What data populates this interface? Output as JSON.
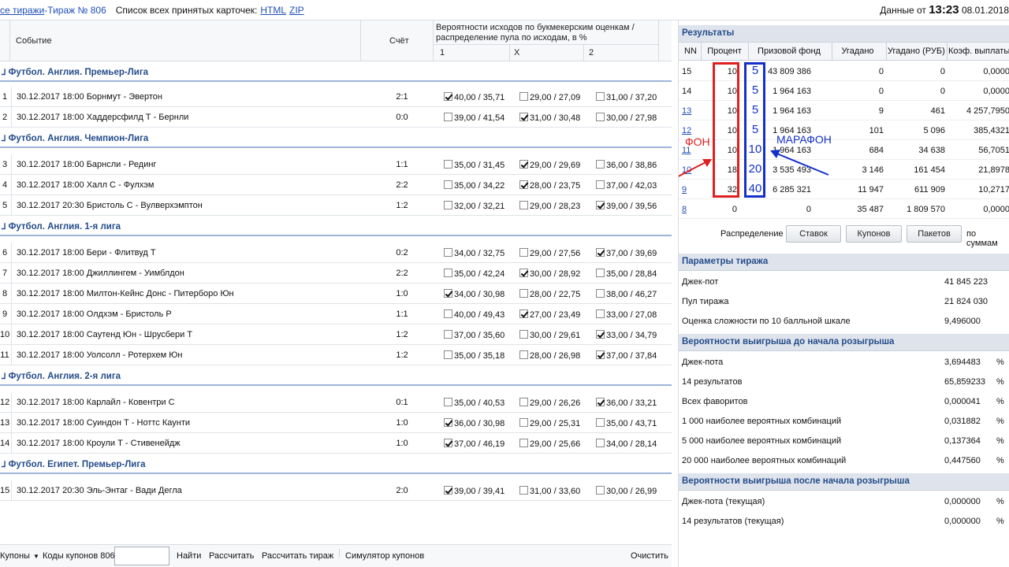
{
  "topbar": {
    "all_draws": "се тиражи",
    "sep": " - ",
    "draw": "Тираж № 806",
    "list_label": "Список всех принятых карточек:",
    "html": "HTML",
    "zip": "ZIP",
    "data_label": "Данные от",
    "time": "13:23",
    "date": "08.01.2018"
  },
  "header": {
    "event": "Событие",
    "score": "Счёт",
    "prob_line1": "Вероятности исходов по букмекерским оценкам /",
    "prob_line2": "распределение пула по исходам, в %",
    "c1": "1",
    "cx": "X",
    "c2": "2"
  },
  "sections": [
    "Футбол. Англия. Премьер-Лига",
    "Футбол. Англия. Чемпион-Лига",
    "Футбол. Англия. 1-я лига",
    "Футбол. Англия. 2-я лига",
    "Футбол. Египет. Премьер-Лига"
  ],
  "events": [
    {
      "n": "1",
      "name": "30.12.2017 18:00 Борнмут - Эвертон",
      "score": "2:1",
      "p1": "40,00 / 35,71",
      "px": "29,00 / 27,09",
      "p2": "31,00 / 37,20",
      "chk": [
        1,
        0,
        0
      ]
    },
    {
      "n": "2",
      "name": "30.12.2017 18:00 Хаддерсфилд Т - Бернли",
      "score": "0:0",
      "p1": "39,00 / 41,54",
      "px": "31,00 / 30,48",
      "p2": "30,00 / 27,98",
      "chk": [
        0,
        1,
        0
      ]
    },
    {
      "n": "3",
      "name": "30.12.2017 18:00 Барнсли - Рединг",
      "score": "1:1",
      "p1": "35,00 / 31,45",
      "px": "29,00 / 29,69",
      "p2": "36,00 / 38,86",
      "chk": [
        0,
        1,
        0
      ]
    },
    {
      "n": "4",
      "name": "30.12.2017 18:00 Халл С - Фулхэм",
      "score": "2:2",
      "p1": "35,00 / 34,22",
      "px": "28,00 / 23,75",
      "p2": "37,00 / 42,03",
      "chk": [
        0,
        1,
        0
      ]
    },
    {
      "n": "5",
      "name": "30.12.2017 20:30 Бристоль С - Вулверхэмптон",
      "score": "1:2",
      "p1": "32,00 / 32,21",
      "px": "29,00 / 28,23",
      "p2": "39,00 / 39,56",
      "chk": [
        0,
        0,
        1
      ]
    },
    {
      "n": "6",
      "name": "30.12.2017 18:00 Бери - Флитвуд Т",
      "score": "0:2",
      "p1": "34,00 / 32,75",
      "px": "29,00 / 27,56",
      "p2": "37,00 / 39,69",
      "chk": [
        0,
        0,
        1
      ]
    },
    {
      "n": "7",
      "name": "30.12.2017 18:00 Джиллингем - Уимблдон",
      "score": "2:2",
      "p1": "35,00 / 42,24",
      "px": "30,00 / 28,92",
      "p2": "35,00 / 28,84",
      "chk": [
        0,
        1,
        0
      ]
    },
    {
      "n": "8",
      "name": "30.12.2017 18:00 Милтон-Кейнс Донс - Питерборо Юн",
      "score": "1:0",
      "p1": "34,00 / 30,98",
      "px": "28,00 / 22,75",
      "p2": "38,00 / 46,27",
      "chk": [
        1,
        0,
        0
      ]
    },
    {
      "n": "9",
      "name": "30.12.2017 18:00 Олдхэм - Бристоль Р",
      "score": "1:1",
      "p1": "40,00 / 49,43",
      "px": "27,00 / 23,49",
      "p2": "33,00 / 27,08",
      "chk": [
        0,
        1,
        0
      ]
    },
    {
      "n": "10",
      "name": "30.12.2017 18:00 Саутенд Юн - Шрусбери Т",
      "score": "1:2",
      "p1": "37,00 / 35,60",
      "px": "30,00 / 29,61",
      "p2": "33,00 / 34,79",
      "chk": [
        0,
        0,
        1
      ]
    },
    {
      "n": "11",
      "name": "30.12.2017 18:00 Уолсолл - Ротерхем Юн",
      "score": "1:2",
      "p1": "35,00 / 35,18",
      "px": "28,00 / 26,98",
      "p2": "37,00 / 37,84",
      "chk": [
        0,
        0,
        1
      ]
    },
    {
      "n": "12",
      "name": "30.12.2017 18:00 Карлайл - Ковентри С",
      "score": "0:1",
      "p1": "35,00 / 40,53",
      "px": "29,00 / 26,26",
      "p2": "36,00 / 33,21",
      "chk": [
        0,
        0,
        1
      ]
    },
    {
      "n": "13",
      "name": "30.12.2017 18:00 Суиндон Т - Ноттс Каунти",
      "score": "1:0",
      "p1": "36,00 / 30,98",
      "px": "29,00 / 25,31",
      "p2": "35,00 / 43,71",
      "chk": [
        1,
        0,
        0
      ]
    },
    {
      "n": "14",
      "name": "30.12.2017 18:00 Кроули Т - Стивенейдж",
      "score": "1:0",
      "p1": "37,00 / 46,19",
      "px": "29,00 / 25,66",
      "p2": "34,00 / 28,14",
      "chk": [
        1,
        0,
        0
      ]
    },
    {
      "n": "15",
      "name": "30.12.2017 20:30 Эль-Энтаг - Вади Дегла",
      "score": "2:0",
      "p1": "39,00 / 39,41",
      "px": "31,00 / 33,60",
      "p2": "30,00 / 26,99",
      "chk": [
        1,
        0,
        0
      ]
    }
  ],
  "footer": {
    "coupons": "Купоны",
    "codes": "Коды купонов 806-",
    "find": "Найти",
    "calc": "Рассчитать",
    "calc_draw": "Рассчитать тираж",
    "sim": "Симулятор купонов",
    "clear": "Очистить"
  },
  "results": {
    "title": "Результаты",
    "cols": [
      "NN",
      "Процент",
      "Призовой фонд",
      "Угадано",
      "Угадано (РУБ)",
      "Коэф. выплаты"
    ],
    "rows": [
      {
        "nn": "15",
        "pct": "10",
        "fund": "43 809 386",
        "hit": "0",
        "rub": "0",
        "k": "0,0000",
        "link": false
      },
      {
        "nn": "14",
        "pct": "10",
        "fund": "1 964 163",
        "hit": "0",
        "rub": "0",
        "k": "0,0000",
        "link": false
      },
      {
        "nn": "13",
        "pct": "10",
        "fund": "1 964 163",
        "hit": "9",
        "rub": "461",
        "k": "4 257,7950",
        "link": true
      },
      {
        "nn": "12",
        "pct": "10",
        "fund": "1 964 163",
        "hit": "101",
        "rub": "5 096",
        "k": "385,4321",
        "link": true
      },
      {
        "nn": "11",
        "pct": "10",
        "fund": "1 964 163",
        "hit": "684",
        "rub": "34 638",
        "k": "56,7051",
        "link": true
      },
      {
        "nn": "10",
        "pct": "18",
        "fund": "3 535 493",
        "hit": "3 146",
        "rub": "161 454",
        "k": "21,8978",
        "link": true
      },
      {
        "nn": "9",
        "pct": "32",
        "fund": "6 285 321",
        "hit": "11 947",
        "rub": "611 909",
        "k": "10,2717",
        "link": true
      },
      {
        "nn": "8",
        "pct": "0",
        "fund": "0",
        "hit": "35 487",
        "rub": "1 809 570",
        "k": "0,0000",
        "link": true
      }
    ],
    "dist_label": "Распределение",
    "b1": "Ставок",
    "b2": "Купонов",
    "b3": "Пакетов",
    "sum": "по суммам"
  },
  "annotation": {
    "fon": "ФОН",
    "marathon": "МАРАФОН",
    "nums": [
      "5",
      "5",
      "5",
      "5",
      "10",
      "20",
      "40"
    ],
    "red": "#e02020",
    "blue": "#1530c8"
  },
  "params": {
    "title": "Параметры тиража",
    "rows": [
      {
        "l": "Джек-пот",
        "v": "41 845 223"
      },
      {
        "l": "Пул тиража",
        "v": "21 824 030"
      },
      {
        "l": "Оценка сложности по 10 балльной шкале",
        "v": "9,496000"
      }
    ]
  },
  "before": {
    "title": "Вероятности выигрыша до начала розыгрыша",
    "rows": [
      {
        "l": "Джек-пота",
        "v": "3,694483",
        "u": "%"
      },
      {
        "l": "14 результатов",
        "v": "65,859233",
        "u": "%"
      },
      {
        "l": "Всех фаворитов",
        "v": "0,000041",
        "u": "%"
      },
      {
        "l": "1 000 наиболее вероятных комбинаций",
        "v": "0,031882",
        "u": "%"
      },
      {
        "l": "5 000 наиболее вероятных комбинаций",
        "v": "0,137364",
        "u": "%"
      },
      {
        "l": "20 000 наиболее вероятных комбинаций",
        "v": "0,447560",
        "u": "%"
      }
    ]
  },
  "after": {
    "title": "Вероятности выигрыша после начала розыгрыша",
    "rows": [
      {
        "l": "Джек-пота (текущая)",
        "v": "0,000000",
        "u": "%"
      },
      {
        "l": "14 результатов (текущая)",
        "v": "0,000000",
        "u": "%"
      }
    ]
  }
}
